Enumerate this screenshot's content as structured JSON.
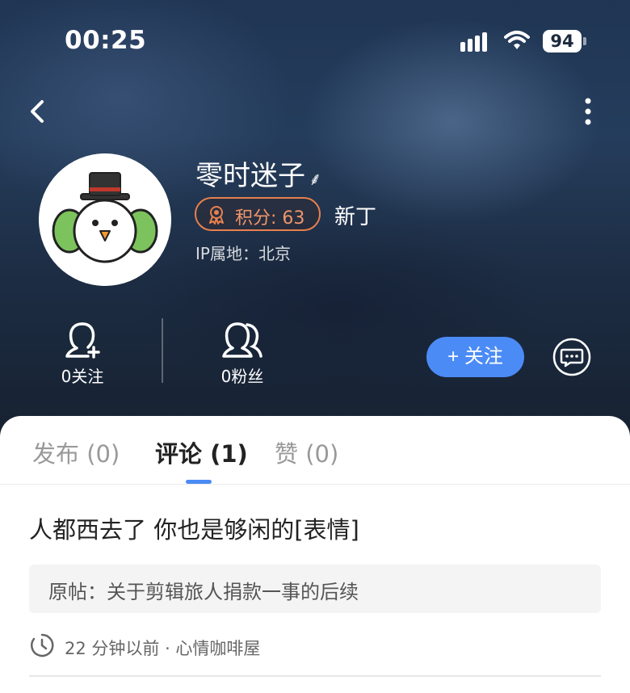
{
  "status_bar": {
    "time": "00:25",
    "battery": "94"
  },
  "profile": {
    "username": "零时迷子",
    "username_suffix": "𝅇",
    "points_label": "积分: 63",
    "rank": "新丁",
    "ip_location": "IP属地：北京",
    "avatar_icon": "snowman-avatar"
  },
  "stats": {
    "following_label": "0关注",
    "followers_label": "0粉丝"
  },
  "actions": {
    "follow_label": "+ 关注",
    "message_icon": "chat-bubble-icon"
  },
  "tabs": [
    {
      "label": "发布 (0)"
    },
    {
      "label": "评论 (1)"
    },
    {
      "label": "赞 (0)"
    }
  ],
  "comment": {
    "text": "人都西去了 你也是够闲的[表情]",
    "original_post": "原帖：关于剪辑旅人捐款一事的后续",
    "meta": "22 分钟以前 · 心情咖啡屋"
  },
  "colors": {
    "accent": "#4b8bf5",
    "badge": "#e8804e"
  }
}
